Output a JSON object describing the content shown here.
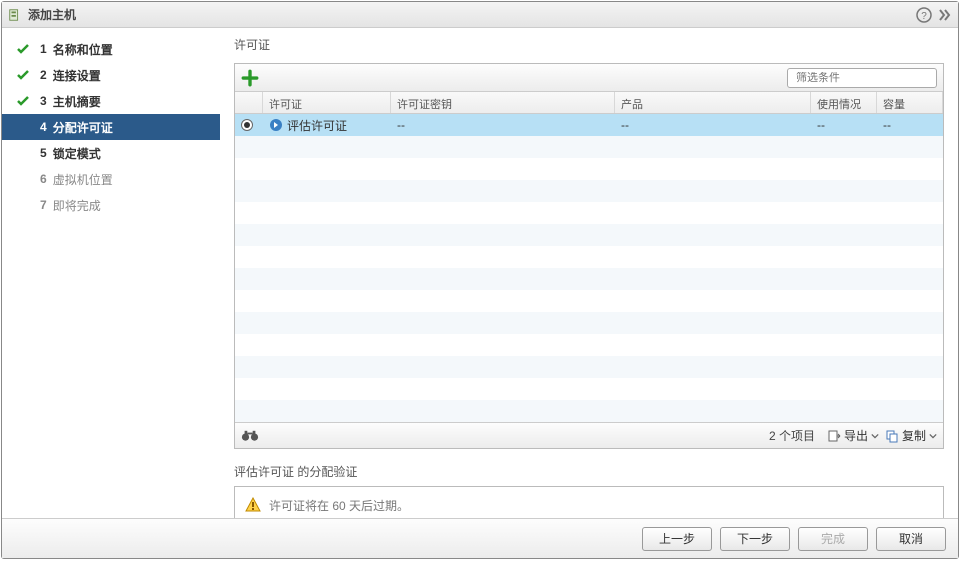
{
  "window": {
    "title": "添加主机"
  },
  "steps": [
    {
      "num": "1",
      "label": "名称和位置",
      "state": "done"
    },
    {
      "num": "2",
      "label": "连接设置",
      "state": "done"
    },
    {
      "num": "3",
      "label": "主机摘要",
      "state": "done"
    },
    {
      "num": "4",
      "label": "分配许可证",
      "state": "current"
    },
    {
      "num": "5",
      "label": "锁定模式",
      "state": "pending"
    },
    {
      "num": "6",
      "label": "虚拟机位置",
      "state": "disabled"
    },
    {
      "num": "7",
      "label": "即将完成",
      "state": "disabled"
    }
  ],
  "license_section": {
    "title": "许可证",
    "filter_placeholder": "筛选条件",
    "columns": {
      "license": "许可证",
      "key": "许可证密钥",
      "product": "产品",
      "usage": "使用情况",
      "capacity": "容量"
    },
    "rows": [
      {
        "selected": true,
        "license": "评估许可证",
        "key": "--",
        "product": "--",
        "usage": "--",
        "capacity": "--"
      },
      {
        "blackout": true
      }
    ],
    "items_count": "2 个项目",
    "export_label": "导出",
    "copy_label": "复制"
  },
  "validation": {
    "title": "评估许可证 的分配验证",
    "message": "许可证将在 60 天后过期。"
  },
  "buttons": {
    "back": "上一步",
    "next": "下一步",
    "finish": "完成",
    "cancel": "取消"
  },
  "icons": {
    "host": "host-icon",
    "help": "help-icon",
    "expand": "expand-icon",
    "check": "check-icon",
    "plus": "plus-icon",
    "search": "search-icon",
    "dropdown": "chevron-down-icon",
    "arrow": "arrow-right-circle-icon",
    "binoculars": "binoculars-icon",
    "export": "export-icon",
    "copy": "copy-icon",
    "warning": "warning-icon"
  }
}
